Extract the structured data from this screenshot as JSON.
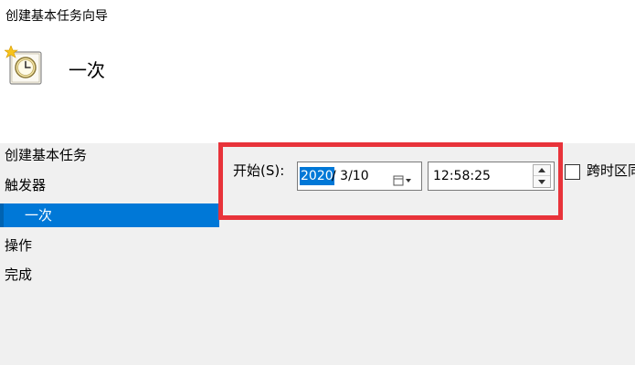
{
  "window": {
    "title": "创建基本任务向导"
  },
  "header": {
    "title": "一次",
    "icon": "clock-icon"
  },
  "nav": {
    "items": [
      {
        "label": "创建基本任务"
      },
      {
        "label": "触发器"
      },
      {
        "label": "一次",
        "active": true
      },
      {
        "label": "操作"
      },
      {
        "label": "完成"
      }
    ]
  },
  "trigger": {
    "start_label": "开始(S):",
    "date_year": "2020",
    "date_rest": "/  3/10",
    "time_value": "12:58:25",
    "sync_timezone_label": "跨时区同步",
    "sync_timezone_checked": false
  },
  "colors": {
    "accent": "#0078d7",
    "highlight_border": "#e8333a",
    "panel_bg": "#f0f0f0",
    "header_bg": "#ffffff"
  }
}
